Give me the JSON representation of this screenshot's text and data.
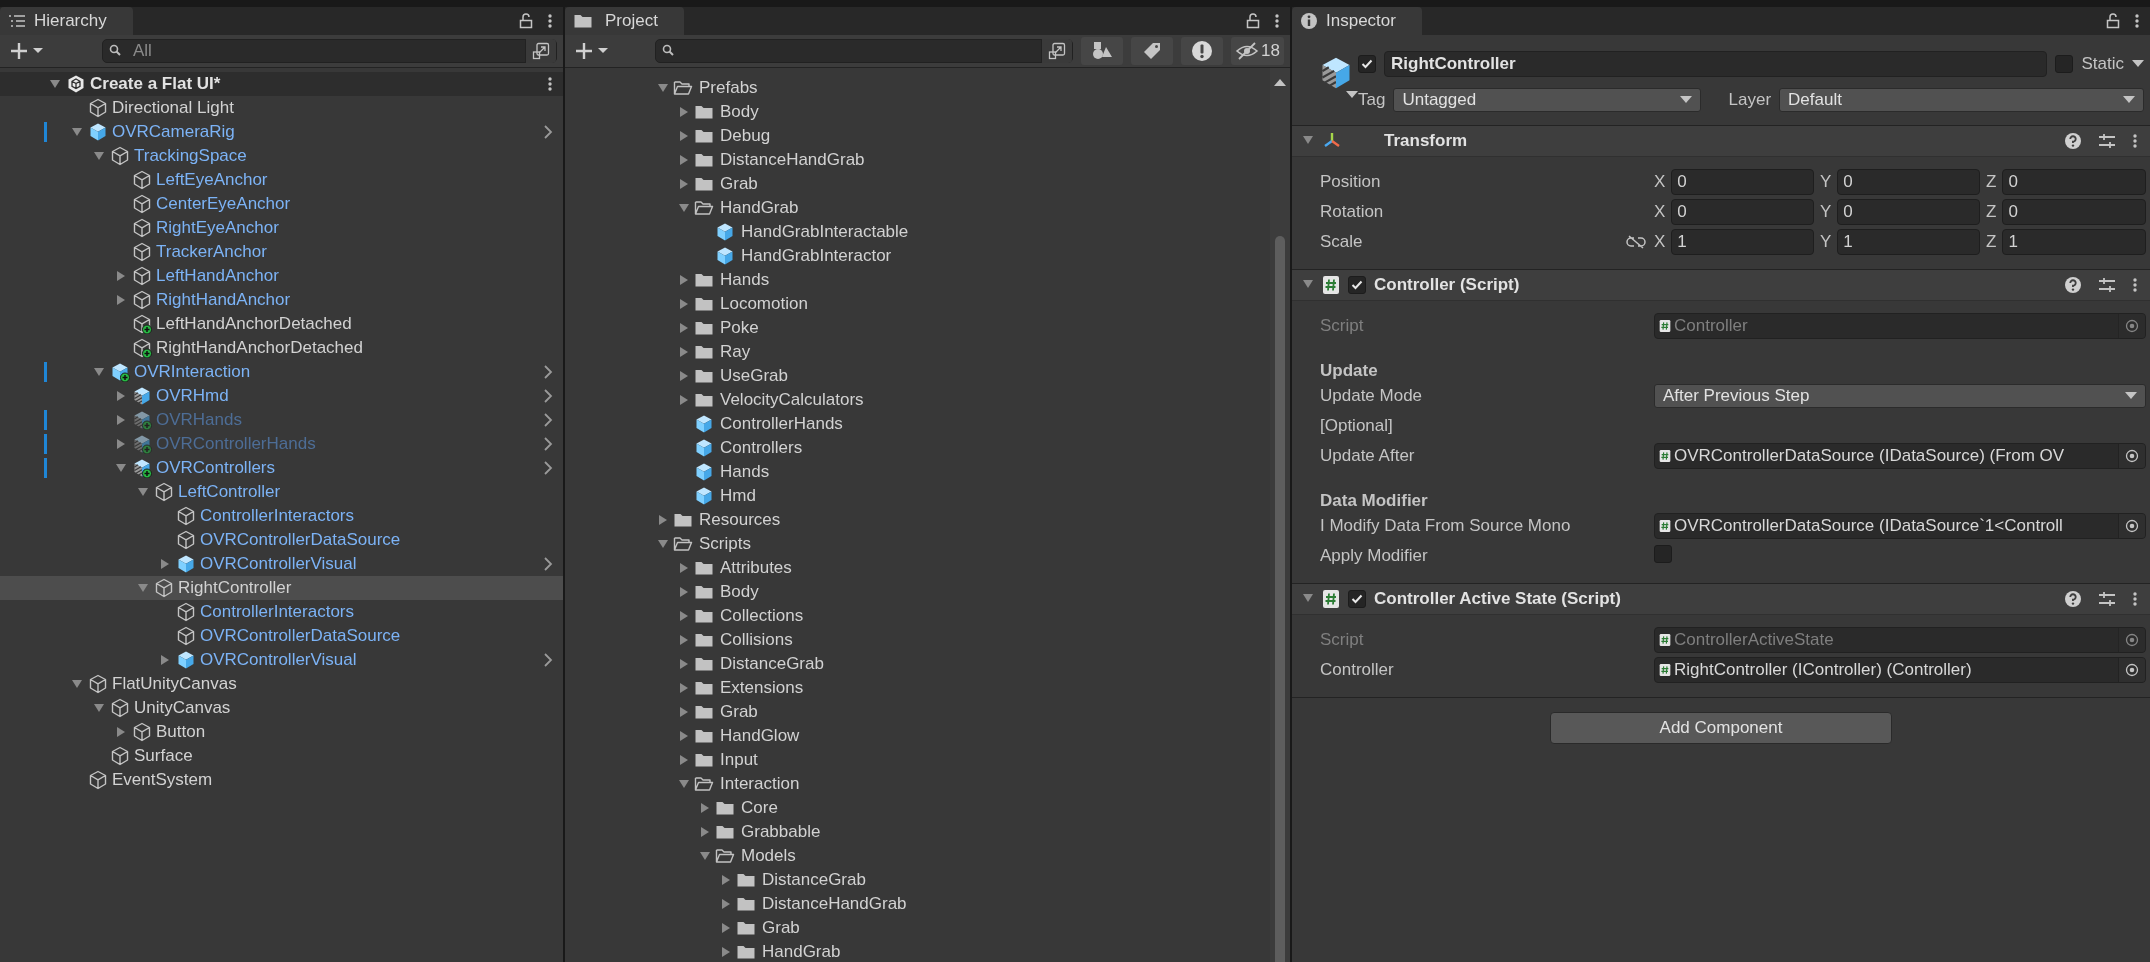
{
  "hierarchy": {
    "tab": "Hierarchy",
    "search": {
      "placeholder": "All"
    },
    "scene": {
      "name": "Create a Flat UI*",
      "expanded": true,
      "children": [
        {
          "name": "Directional Light",
          "kind": "cube",
          "prefab_part": false,
          "selected": false
        },
        {
          "name": "OVRCameraRig",
          "kind": "prefab",
          "prefab_part": true,
          "selected": false,
          "expanded": true,
          "overridden": true,
          "chevron": true,
          "children": [
            {
              "name": "TrackingSpace",
              "kind": "cube",
              "prefab_part": true,
              "selected": false,
              "expanded": true,
              "children": [
                {
                  "name": "LeftEyeAnchor",
                  "kind": "cube",
                  "prefab_part": true,
                  "selected": false
                },
                {
                  "name": "CenterEyeAnchor",
                  "kind": "cube",
                  "prefab_part": true,
                  "selected": false
                },
                {
                  "name": "RightEyeAnchor",
                  "kind": "cube",
                  "prefab_part": true,
                  "selected": false
                },
                {
                  "name": "TrackerAnchor",
                  "kind": "cube",
                  "prefab_part": true,
                  "selected": false
                },
                {
                  "name": "LeftHandAnchor",
                  "kind": "cube",
                  "prefab_part": true,
                  "selected": false,
                  "expanded": false
                },
                {
                  "name": "RightHandAnchor",
                  "kind": "cube",
                  "prefab_part": true,
                  "selected": false,
                  "expanded": false
                },
                {
                  "name": "LeftHandAnchorDetached",
                  "kind": "cube",
                  "added": true,
                  "prefab_part": false,
                  "selected": false
                },
                {
                  "name": "RightHandAnchorDetached",
                  "kind": "cube",
                  "added": true,
                  "prefab_part": false,
                  "selected": false
                }
              ]
            },
            {
              "name": "OVRInteraction",
              "kind": "prefab",
              "added": true,
              "prefab_part": true,
              "selected": false,
              "expanded": true,
              "overridden": true,
              "chevron": true,
              "children": [
                {
                  "name": "OVRHmd",
                  "kind": "variant",
                  "prefab_part": true,
                  "selected": false,
                  "expanded": false,
                  "chevron": true
                },
                {
                  "name": "OVRHands",
                  "kind": "variant",
                  "added": true,
                  "prefab_part": true,
                  "active": false,
                  "selected": false,
                  "expanded": false,
                  "overridden": true,
                  "chevron": true
                },
                {
                  "name": "OVRControllerHands",
                  "kind": "variant",
                  "added": true,
                  "prefab_part": true,
                  "active": false,
                  "selected": false,
                  "expanded": false,
                  "overridden": true,
                  "chevron": true
                },
                {
                  "name": "OVRControllers",
                  "kind": "variant",
                  "added": true,
                  "prefab_part": true,
                  "selected": false,
                  "expanded": true,
                  "overridden": true,
                  "chevron": true,
                  "children": [
                    {
                      "name": "LeftController",
                      "kind": "cube",
                      "prefab_part": true,
                      "selected": false,
                      "expanded": true,
                      "children": [
                        {
                          "name": "ControllerInteractors",
                          "kind": "cube",
                          "prefab_part": true,
                          "selected": false
                        },
                        {
                          "name": "OVRControllerDataSource",
                          "kind": "cube",
                          "prefab_part": true,
                          "selected": false
                        },
                        {
                          "name": "OVRControllerVisual",
                          "kind": "prefab",
                          "prefab_part": true,
                          "selected": false,
                          "expanded": false,
                          "chevron": true
                        }
                      ]
                    },
                    {
                      "name": "RightController",
                      "kind": "cube",
                      "prefab_part": false,
                      "selected": true,
                      "expanded": true,
                      "children": [
                        {
                          "name": "ControllerInteractors",
                          "kind": "cube",
                          "prefab_part": true,
                          "selected": false
                        },
                        {
                          "name": "OVRControllerDataSource",
                          "kind": "cube",
                          "prefab_part": true,
                          "selected": false
                        },
                        {
                          "name": "OVRControllerVisual",
                          "kind": "prefab",
                          "prefab_part": true,
                          "selected": false,
                          "expanded": false,
                          "chevron": true
                        }
                      ]
                    }
                  ]
                }
              ]
            }
          ]
        },
        {
          "name": "FlatUnityCanvas",
          "kind": "cube",
          "prefab_part": false,
          "selected": false,
          "expanded": true,
          "children": [
            {
              "name": "UnityCanvas",
              "kind": "cube",
              "prefab_part": false,
              "selected": false,
              "expanded": true,
              "children": [
                {
                  "name": "Button",
                  "kind": "cube",
                  "prefab_part": false,
                  "selected": false,
                  "expanded": false
                }
              ]
            },
            {
              "name": "Surface",
              "kind": "cube",
              "prefab_part": false,
              "selected": false
            }
          ]
        },
        {
          "name": "EventSystem",
          "kind": "cube",
          "prefab_part": false,
          "selected": false
        }
      ]
    }
  },
  "project": {
    "tab": "Project",
    "hidden_count": "18",
    "tree": [
      {
        "name": "Prefabs",
        "kind": "folder",
        "expanded": true,
        "children": [
          {
            "name": "Body",
            "kind": "folder",
            "expanded": false
          },
          {
            "name": "Debug",
            "kind": "folder",
            "expanded": false
          },
          {
            "name": "DistanceHandGrab",
            "kind": "folder",
            "expanded": false
          },
          {
            "name": "Grab",
            "kind": "folder",
            "expanded": false
          },
          {
            "name": "HandGrab",
            "kind": "folder",
            "expanded": true,
            "children": [
              {
                "name": "HandGrabInteractable",
                "kind": "prefab"
              },
              {
                "name": "HandGrabInteractor",
                "kind": "prefab"
              }
            ]
          },
          {
            "name": "Hands",
            "kind": "folder",
            "expanded": false
          },
          {
            "name": "Locomotion",
            "kind": "folder",
            "expanded": false
          },
          {
            "name": "Poke",
            "kind": "folder",
            "expanded": false
          },
          {
            "name": "Ray",
            "kind": "folder",
            "expanded": false
          },
          {
            "name": "UseGrab",
            "kind": "folder",
            "expanded": false
          },
          {
            "name": "VelocityCalculators",
            "kind": "folder",
            "expanded": false
          },
          {
            "name": "ControllerHands",
            "kind": "prefab"
          },
          {
            "name": "Controllers",
            "kind": "prefab"
          },
          {
            "name": "Hands",
            "kind": "prefab"
          },
          {
            "name": "Hmd",
            "kind": "prefab"
          }
        ]
      },
      {
        "name": "Resources",
        "kind": "folder",
        "expanded": false
      },
      {
        "name": "Scripts",
        "kind": "folder",
        "expanded": true,
        "children": [
          {
            "name": "Attributes",
            "kind": "folder",
            "expanded": false
          },
          {
            "name": "Body",
            "kind": "folder",
            "expanded": false
          },
          {
            "name": "Collections",
            "kind": "folder",
            "expanded": false
          },
          {
            "name": "Collisions",
            "kind": "folder",
            "expanded": false
          },
          {
            "name": "DistanceGrab",
            "kind": "folder",
            "expanded": false
          },
          {
            "name": "Extensions",
            "kind": "folder",
            "expanded": false
          },
          {
            "name": "Grab",
            "kind": "folder",
            "expanded": false
          },
          {
            "name": "HandGlow",
            "kind": "folder",
            "expanded": false
          },
          {
            "name": "Input",
            "kind": "folder",
            "expanded": false
          },
          {
            "name": "Interaction",
            "kind": "folder",
            "expanded": true,
            "children": [
              {
                "name": "Core",
                "kind": "folder",
                "expanded": false
              },
              {
                "name": "Grabbable",
                "kind": "folder",
                "expanded": false
              },
              {
                "name": "Models",
                "kind": "folder",
                "expanded": true,
                "children": [
                  {
                    "name": "DistanceGrab",
                    "kind": "folder",
                    "expanded": false
                  },
                  {
                    "name": "DistanceHandGrab",
                    "kind": "folder",
                    "expanded": false
                  },
                  {
                    "name": "Grab",
                    "kind": "folder",
                    "expanded": false
                  },
                  {
                    "name": "HandGrab",
                    "kind": "folder",
                    "expanded": false
                  }
                ]
              }
            ]
          }
        ]
      }
    ]
  },
  "inspector": {
    "tab": "Inspector",
    "object": {
      "active": true,
      "name": "RightController",
      "static": false,
      "static_label": "Static",
      "tag_label": "Tag",
      "tag": "Untagged",
      "layer_label": "Layer",
      "layer": "Default"
    },
    "components": [
      {
        "kind": "transform",
        "title": "Transform",
        "expanded": true,
        "props": [
          {
            "kind": "vector3",
            "label": "Position",
            "fields": [
              {
                "axis": "X",
                "value": "0"
              },
              {
                "axis": "Y",
                "value": "0"
              },
              {
                "axis": "Z",
                "value": "0"
              }
            ]
          },
          {
            "kind": "vector3",
            "label": "Rotation",
            "fields": [
              {
                "axis": "X",
                "value": "0"
              },
              {
                "axis": "Y",
                "value": "0"
              },
              {
                "axis": "Z",
                "value": "0"
              }
            ]
          },
          {
            "kind": "vector3",
            "label": "Scale",
            "link_icon": true,
            "fields": [
              {
                "axis": "X",
                "value": "1"
              },
              {
                "axis": "Y",
                "value": "1"
              },
              {
                "axis": "Z",
                "value": "1"
              }
            ]
          }
        ]
      },
      {
        "kind": "script",
        "title": "Controller (Script)",
        "enabled": true,
        "expanded": true,
        "props": [
          {
            "kind": "object",
            "label": "Script",
            "value": "Controller",
            "disabled": true
          },
          {
            "kind": "header",
            "label": "Update"
          },
          {
            "kind": "dropdown",
            "label": "Update Mode",
            "value": "After Previous Step"
          },
          {
            "kind": "label",
            "label": "[Optional]"
          },
          {
            "kind": "object",
            "label": "Update After",
            "value": "OVRControllerDataSource (IDataSource) (From OV",
            "disabled": false
          },
          {
            "kind": "header",
            "label": "Data Modifier"
          },
          {
            "kind": "object",
            "label": "I Modify Data From Source Mono",
            "value": "OVRControllerDataSource (IDataSource`1<Controll",
            "disabled": false
          },
          {
            "kind": "checkbox",
            "label": "Apply Modifier",
            "checked": false
          }
        ]
      },
      {
        "kind": "script",
        "title": "Controller Active State (Script)",
        "enabled": true,
        "expanded": true,
        "props": [
          {
            "kind": "object",
            "label": "Script",
            "value": "ControllerActiveState",
            "disabled": true
          },
          {
            "kind": "object",
            "label": "Controller",
            "value": "RightController (IController) (Controller)",
            "disabled": false
          }
        ]
      }
    ],
    "add_button": "Add Component"
  }
}
